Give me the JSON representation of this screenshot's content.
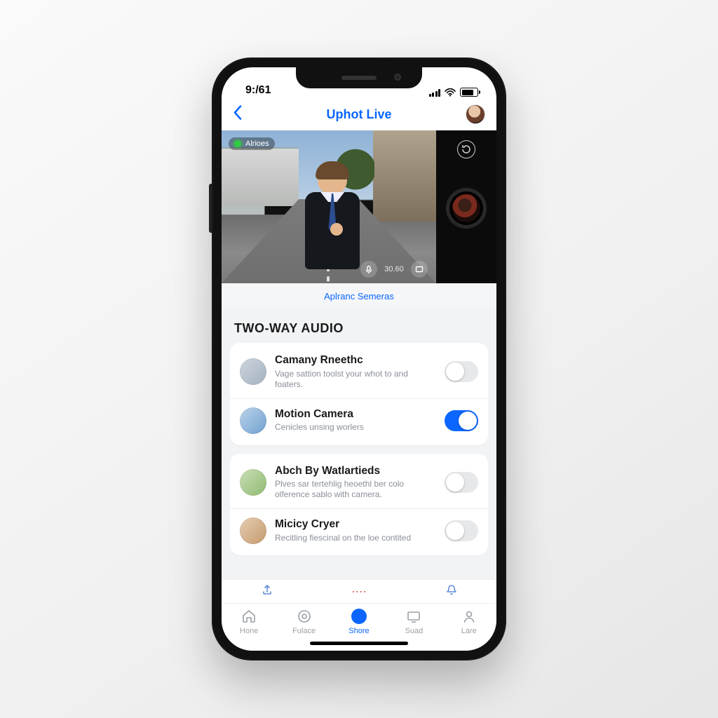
{
  "status": {
    "time": "9:/61"
  },
  "header": {
    "title": "Uphot Live"
  },
  "video": {
    "badge_label": "Alrioes",
    "timestamp": "30.60"
  },
  "sublink": {
    "label": "Aplranc Semeras"
  },
  "section": {
    "title": "TWO-WAY AUDIO"
  },
  "rows": [
    {
      "name": "Camany Rneethc",
      "desc": "Vage sattion toolst your whot to and foaters.",
      "on": false
    },
    {
      "name": "Motion Camera",
      "desc": "Cenicles unsing worlers",
      "on": true
    },
    {
      "name": "Abch By Watlartieds",
      "desc": "Plves sar tertehlig heoethl ber colo olference sablo with camera.",
      "on": false
    },
    {
      "name": "Micicy Cryer",
      "desc": "Recitling fiescinal on the loe contited",
      "on": false
    }
  ],
  "quickbar": {
    "mid": "∙∙∙∙"
  },
  "tabs": [
    {
      "label": "Hone"
    },
    {
      "label": "Fulace"
    },
    {
      "label": "Shore"
    },
    {
      "label": "Suad"
    },
    {
      "label": "Lare"
    }
  ]
}
